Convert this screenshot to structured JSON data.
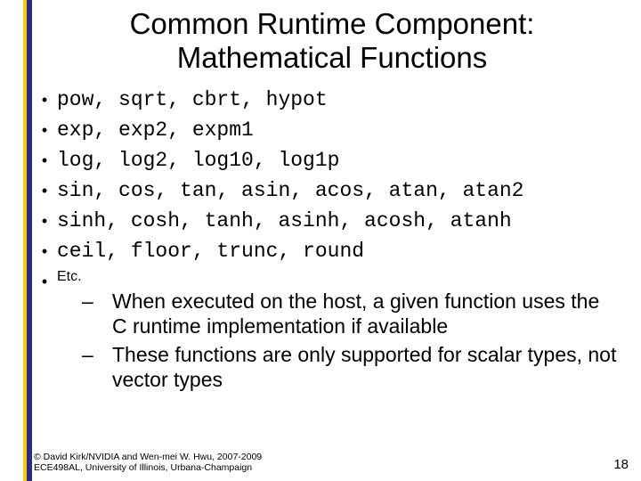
{
  "title_line1": "Common Runtime Component:",
  "title_line2": "Mathematical Functions",
  "items": [
    "pow, sqrt, cbrt, hypot",
    "exp, exp2, expm1",
    "log, log2, log10, log1p",
    "sin, cos, tan, asin, acos, atan, atan2",
    "sinh, cosh, tanh, asinh, acosh, atanh",
    "ceil, floor, trunc, round"
  ],
  "etc_label": "Etc.",
  "sub_items": [
    "When executed on the host, a given function uses the C runtime implementation if available",
    "These functions are only supported for scalar types, not vector types"
  ],
  "footer_line1": "© David Kirk/NVIDIA and Wen-mei W. Hwu, 2007-2009",
  "footer_line2": "ECE498AL, University of Illinois, Urbana-Champaign",
  "page_number": "18"
}
